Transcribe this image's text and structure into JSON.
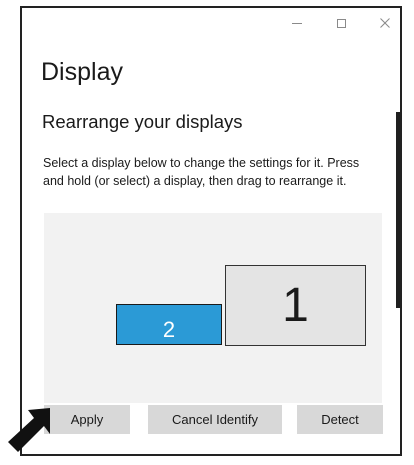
{
  "window": {
    "controls": {
      "minimize": "minimize-icon",
      "maximize": "maximize-icon",
      "close": "close-icon"
    }
  },
  "page": {
    "title": "Display",
    "subtitle": "Rearrange your displays",
    "description": "Select a display below to change the settings for it. Press and hold (or select) a display, then drag to rearrange it."
  },
  "displays": [
    {
      "label": "1",
      "color": "#e4e4e4"
    },
    {
      "label": "2",
      "color": "#2b9ad6"
    }
  ],
  "buttons": {
    "apply": "Apply",
    "identify": "Cancel Identify",
    "detect": "Detect"
  },
  "colors": {
    "accent": "#2b9ad6",
    "button_bg": "#d8d8d8",
    "panel_bg": "#f2f2f2"
  }
}
